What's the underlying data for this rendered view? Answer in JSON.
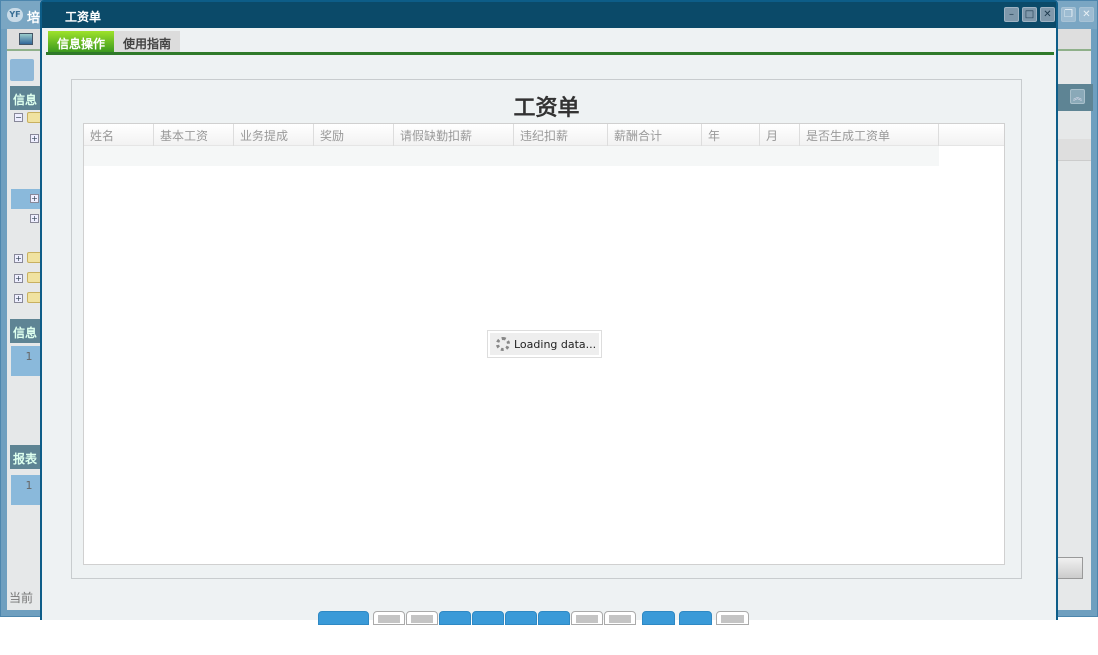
{
  "background_window": {
    "title_partial": "培",
    "panels": [
      {
        "label_partial": "信息"
      },
      {
        "label_partial": "信息"
      },
      {
        "label_partial": "报表"
      }
    ],
    "row_numbers": [
      "1",
      "1"
    ],
    "status_partial": "当前"
  },
  "modal": {
    "title": "工资单",
    "tabs": [
      {
        "label": "信息操作",
        "active": true
      },
      {
        "label": "使用指南",
        "active": false
      }
    ],
    "heading": "工资单",
    "columns": [
      "姓名",
      "基本工资",
      "业务提成",
      "奖励",
      "请假缺勤扣薪",
      "违纪扣薪",
      "薪酬合计",
      "年",
      "月",
      "是否生成工资单"
    ],
    "loading_text": "Loading data...",
    "window_buttons": [
      "minimize-icon",
      "maximize-icon",
      "close-icon"
    ]
  },
  "colors": {
    "title_bar": "#0b4a69",
    "active_tab": "#5cb822",
    "accent_line": "#2f7a2a",
    "button_blue": "#3a9ad8"
  }
}
